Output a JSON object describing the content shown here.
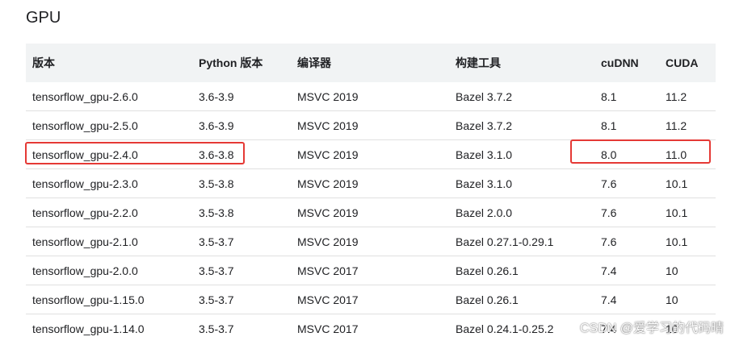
{
  "section": {
    "title": "GPU"
  },
  "table": {
    "headers": [
      "版本",
      "Python 版本",
      "编译器",
      "构建工具",
      "cuDNN",
      "CUDA"
    ],
    "rows": [
      [
        "tensorflow_gpu-2.6.0",
        "3.6-3.9",
        "MSVC 2019",
        "Bazel 3.7.2",
        "8.1",
        "11.2"
      ],
      [
        "tensorflow_gpu-2.5.0",
        "3.6-3.9",
        "MSVC 2019",
        "Bazel 3.7.2",
        "8.1",
        "11.2"
      ],
      [
        "tensorflow_gpu-2.4.0",
        "3.6-3.8",
        "MSVC 2019",
        "Bazel 3.1.0",
        "8.0",
        "11.0"
      ],
      [
        "tensorflow_gpu-2.3.0",
        "3.5-3.8",
        "MSVC 2019",
        "Bazel 3.1.0",
        "7.6",
        "10.1"
      ],
      [
        "tensorflow_gpu-2.2.0",
        "3.5-3.8",
        "MSVC 2019",
        "Bazel 2.0.0",
        "7.6",
        "10.1"
      ],
      [
        "tensorflow_gpu-2.1.0",
        "3.5-3.7",
        "MSVC 2019",
        "Bazel 0.27.1-0.29.1",
        "7.6",
        "10.1"
      ],
      [
        "tensorflow_gpu-2.0.0",
        "3.5-3.7",
        "MSVC 2017",
        "Bazel 0.26.1",
        "7.4",
        "10"
      ],
      [
        "tensorflow_gpu-1.15.0",
        "3.5-3.7",
        "MSVC 2017",
        "Bazel 0.26.1",
        "7.4",
        "10"
      ],
      [
        "tensorflow_gpu-1.14.0",
        "3.5-3.7",
        "MSVC 2017",
        "Bazel 0.24.1-0.25.2",
        "7.4",
        "10"
      ]
    ]
  },
  "watermark": "CSDN @爱学习的代码晴",
  "colors": {
    "header_bg": "#f1f3f4",
    "highlight": "#e53935",
    "row_border": "#e0e0e0"
  }
}
